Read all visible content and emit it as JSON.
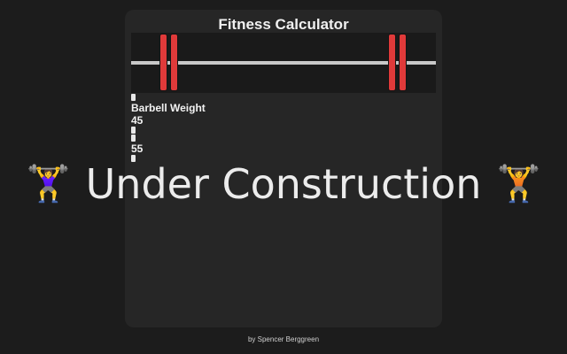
{
  "app": {
    "title": "Fitness Calculator"
  },
  "weights": {
    "barbell_label": "Barbell Weight",
    "barbell_value": "45",
    "total_value": "55"
  },
  "overlay": {
    "text": "Under Construction",
    "left_emoji": "🏋️‍♀️",
    "right_emoji": "🏋️"
  },
  "footer": {
    "credit": "by Spencer Berggreen"
  },
  "colors": {
    "background": "#1c1c1c",
    "card": "#262626",
    "plate": "#e03a3a",
    "bar": "#c8c8c8"
  },
  "icons": {
    "left_overlay": "woman-lifting-weights-icon",
    "right_overlay": "person-lifting-weights-icon"
  }
}
